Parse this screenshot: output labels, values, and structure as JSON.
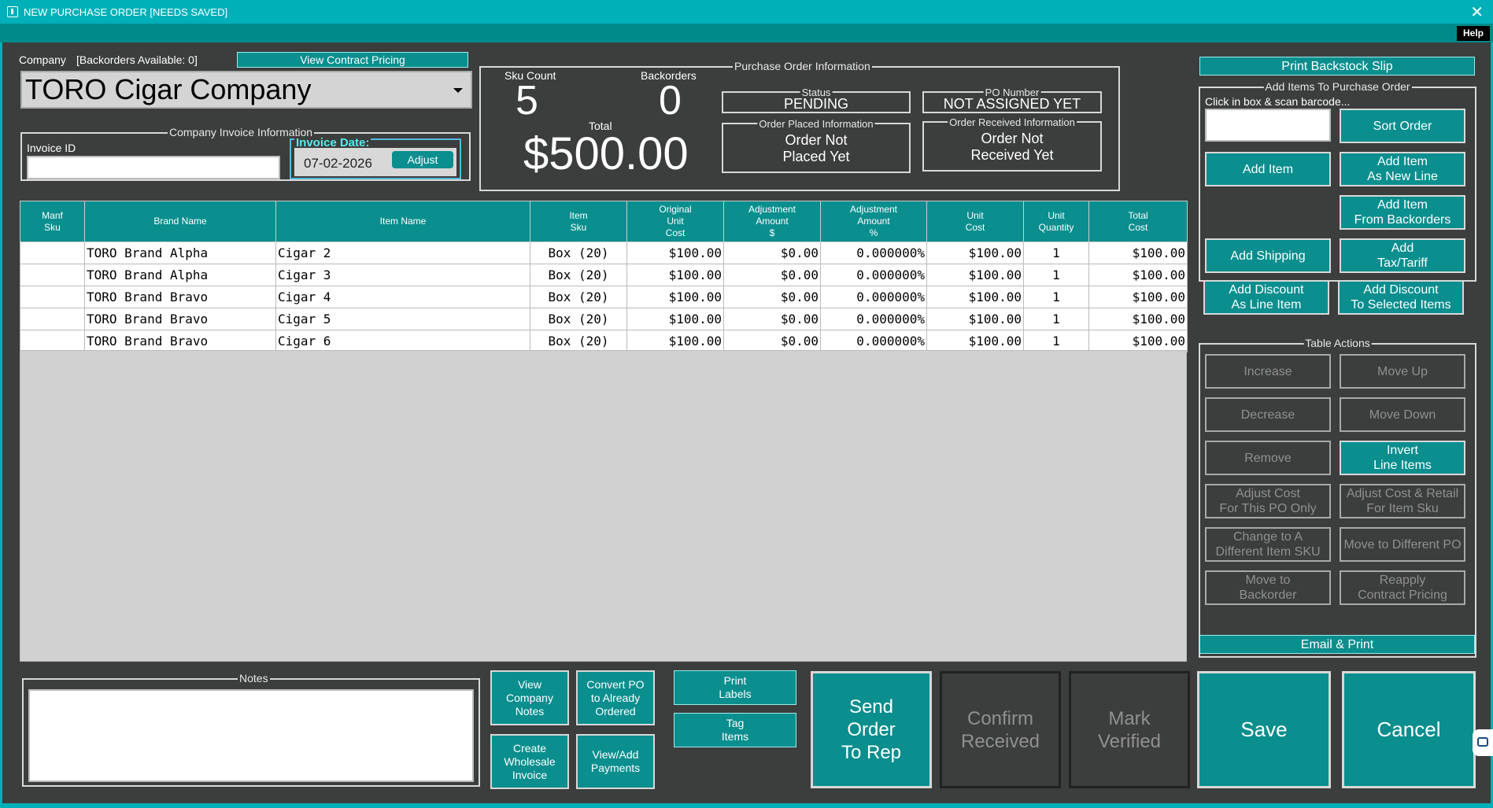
{
  "window": {
    "title": "NEW PURCHASE ORDER [NEEDS SAVED]",
    "help": "Help"
  },
  "company": {
    "label": "Company",
    "backorders_text": "[Backorders Available: 0]",
    "view_contract_pricing": "View Contract Pricing",
    "selected": "TORO Cigar Company"
  },
  "invoice": {
    "legend": "Company Invoice Information",
    "id_label": "Invoice ID",
    "id_value": "",
    "date_legend": "Invoice Date:",
    "date_value": "07-02-2026",
    "adjust": "Adjust"
  },
  "summary": {
    "sku_count_label": "Sku Count",
    "sku_count": "5",
    "backorders_label": "Backorders",
    "backorders": "0",
    "total_label": "Total",
    "total": "$500.00"
  },
  "po_info": {
    "legend": "Purchase Order Information",
    "status_legend": "Status",
    "status": "PENDING",
    "po_number_legend": "PO Number",
    "po_number": "NOT ASSIGNED YET",
    "placed_legend": "Order Placed Information",
    "placed_line1": "Order Not",
    "placed_line2": "Placed Yet",
    "received_legend": "Order Received Information",
    "received_line1": "Order Not",
    "received_line2": "Received Yet"
  },
  "table": {
    "headers": [
      [
        "Manf",
        "Sku"
      ],
      [
        "Brand Name"
      ],
      [
        "Item Name"
      ],
      [
        "Item",
        "Sku"
      ],
      [
        "Original",
        "Unit",
        "Cost"
      ],
      [
        "Adjustment",
        "Amount",
        "$"
      ],
      [
        "Adjustment",
        "Amount",
        "%"
      ],
      [
        "Unit",
        "Cost"
      ],
      [
        "Unit",
        "Quantity"
      ],
      [
        "Total",
        "Cost"
      ]
    ],
    "rows": [
      [
        "",
        "TORO Brand Alpha",
        "Cigar 2",
        "Box (20)",
        "$100.00",
        "$0.00",
        "0.000000%",
        "$100.00",
        "1",
        "$100.00"
      ],
      [
        "",
        "TORO Brand Alpha",
        "Cigar 3",
        "Box (20)",
        "$100.00",
        "$0.00",
        "0.000000%",
        "$100.00",
        "1",
        "$100.00"
      ],
      [
        "",
        "TORO Brand Bravo",
        "Cigar 4",
        "Box (20)",
        "$100.00",
        "$0.00",
        "0.000000%",
        "$100.00",
        "1",
        "$100.00"
      ],
      [
        "",
        "TORO Brand Bravo",
        "Cigar 5",
        "Box (20)",
        "$100.00",
        "$0.00",
        "0.000000%",
        "$100.00",
        "1",
        "$100.00"
      ],
      [
        "",
        "TORO Brand Bravo",
        "Cigar 6",
        "Box (20)",
        "$100.00",
        "$0.00",
        "0.000000%",
        "$100.00",
        "1",
        "$100.00"
      ]
    ]
  },
  "right": {
    "print_backstock": "Print Backstock Slip",
    "add_items_legend": "Add Items To Purchase Order",
    "scan_hint": "Click in box & scan barcode...",
    "sort_order": "Sort Order",
    "add_item": "Add Item",
    "add_item_new_line": "Add Item\nAs New Line",
    "add_item_backorders": "Add Item\nFrom Backorders",
    "add_shipping": "Add Shipping",
    "add_tax": "Add\nTax/Tariff",
    "add_discount_line": "Add Discount\nAs Line Item",
    "add_discount_selected": "Add Discount\nTo Selected Items",
    "table_actions_legend": "Table Actions",
    "increase": "Increase",
    "move_up": "Move Up",
    "decrease": "Decrease",
    "move_down": "Move Down",
    "remove": "Remove",
    "invert": "Invert\nLine Items",
    "adjust_cost_po": "Adjust Cost\nFor This PO Only",
    "adjust_cost_retail": "Adjust Cost & Retail\nFor Item Sku",
    "change_sku": "Change to A\nDifferent Item SKU",
    "move_po": "Move to Different PO",
    "move_backorder": "Move to\nBackorder",
    "reapply_pricing": "Reapply\nContract Pricing",
    "email_print": "Email & Print"
  },
  "bottom": {
    "notes_legend": "Notes",
    "view_company_notes": "View\nCompany\nNotes",
    "convert_po": "Convert PO\nto Already\nOrdered",
    "create_wholesale": "Create\nWholesale\nInvoice",
    "view_payments": "View/Add\nPayments",
    "print_labels": "Print\nLabels",
    "tag_items": "Tag\nItems",
    "send_order": "Send\nOrder\nTo Rep",
    "confirm_received": "Confirm\nReceived",
    "mark_verified": "Mark\nVerified",
    "save": "Save",
    "cancel": "Cancel"
  }
}
